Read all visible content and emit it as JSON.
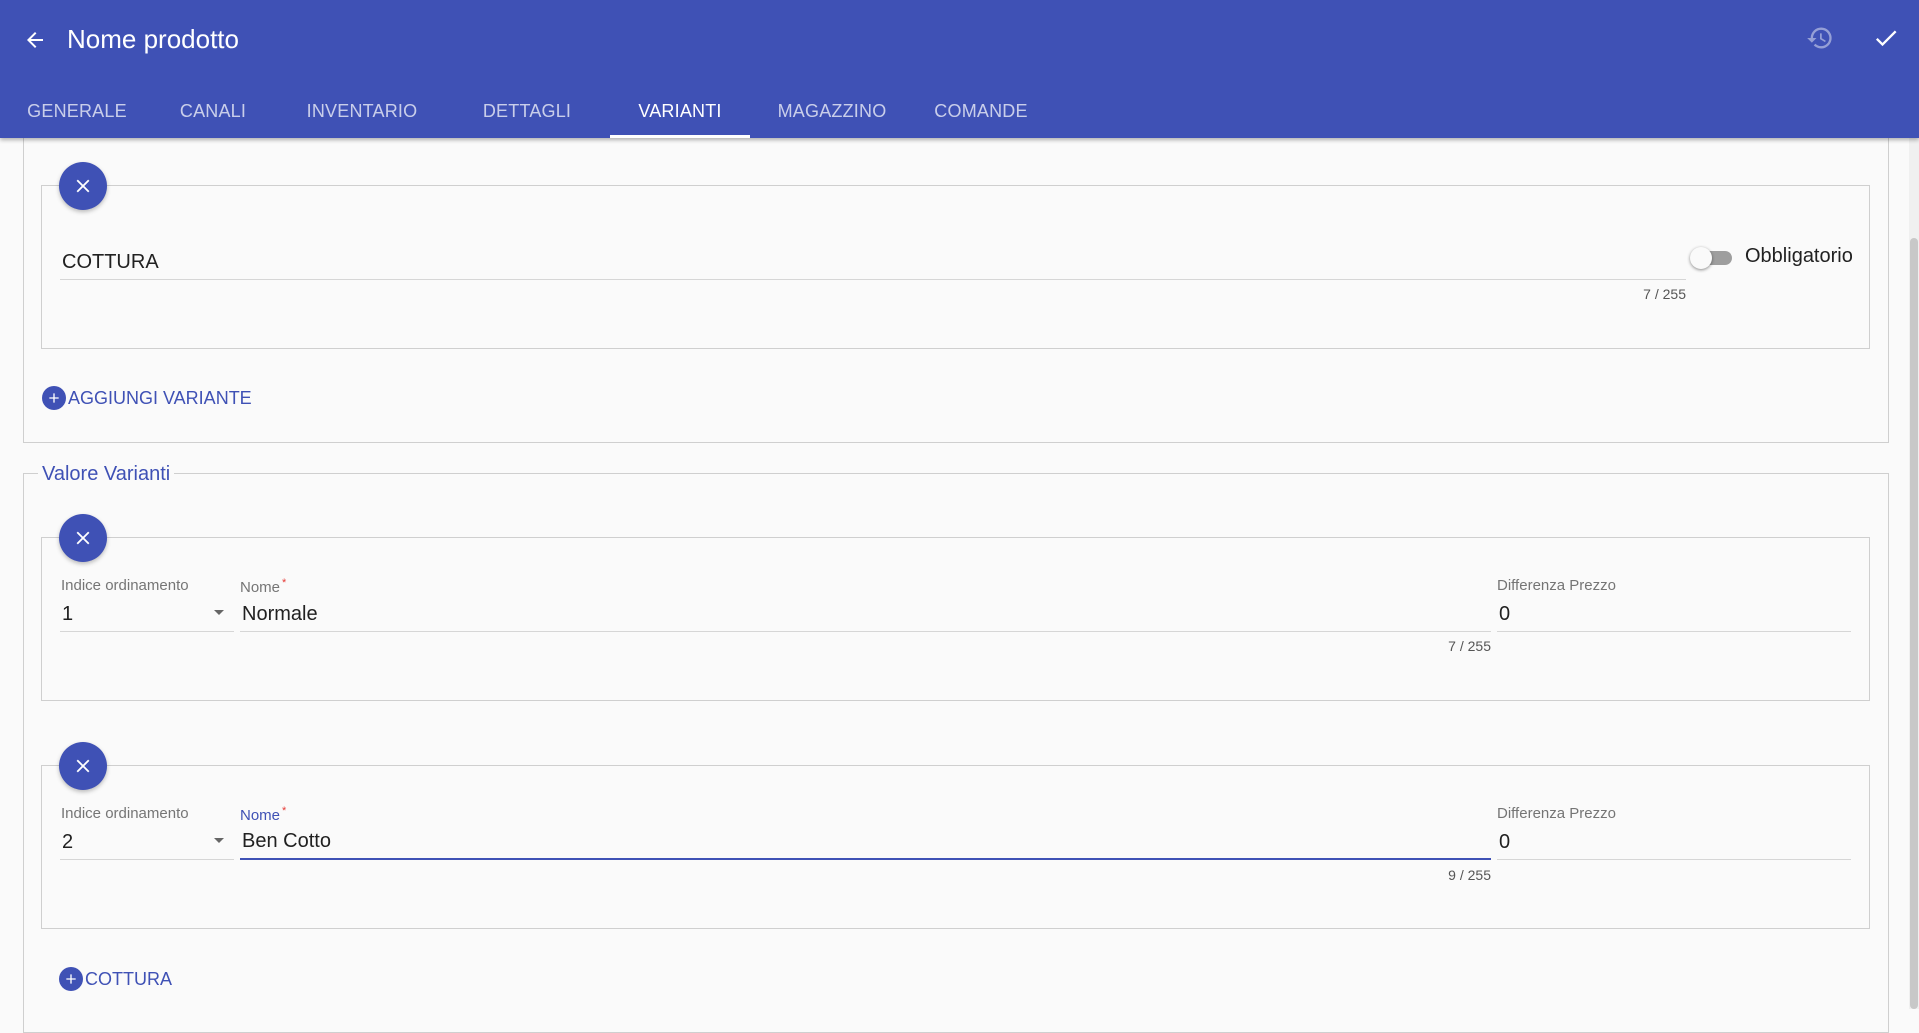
{
  "header": {
    "title": "Nome prodotto",
    "back_icon": "arrow-left-icon",
    "reset_icon": "restore-icon",
    "save_icon": "check-icon",
    "color": "#3f51b5"
  },
  "tabs": [
    {
      "label": "GENERALE",
      "active": false
    },
    {
      "label": "CANALI",
      "active": false
    },
    {
      "label": "INVENTARIO",
      "active": false
    },
    {
      "label": "DETTAGLI",
      "active": false
    },
    {
      "label": "VARIANTI",
      "active": true
    },
    {
      "label": "MAGAZZINO",
      "active": false
    },
    {
      "label": "COMANDE",
      "active": false
    }
  ],
  "variant_group": {
    "name_value": "COTTURA",
    "counter": "7 / 255",
    "toggle_label": "Obbligatorio",
    "toggle_on": false,
    "add_variant_label": "AGGIUNGI VARIANTE"
  },
  "values_section": {
    "legend": "Valore Varianti",
    "labels": {
      "index": "Indice ordinamento",
      "name": "Nome",
      "required_mark": "*",
      "price_diff": "Differenza Prezzo"
    },
    "rows": [
      {
        "index": "1",
        "name": "Normale",
        "counter": "7 / 255",
        "price_diff": "0"
      },
      {
        "index": "2",
        "name": "Ben Cotto",
        "counter": "9 / 255",
        "price_diff": "0"
      }
    ],
    "add_value_label": "COTTURA"
  }
}
